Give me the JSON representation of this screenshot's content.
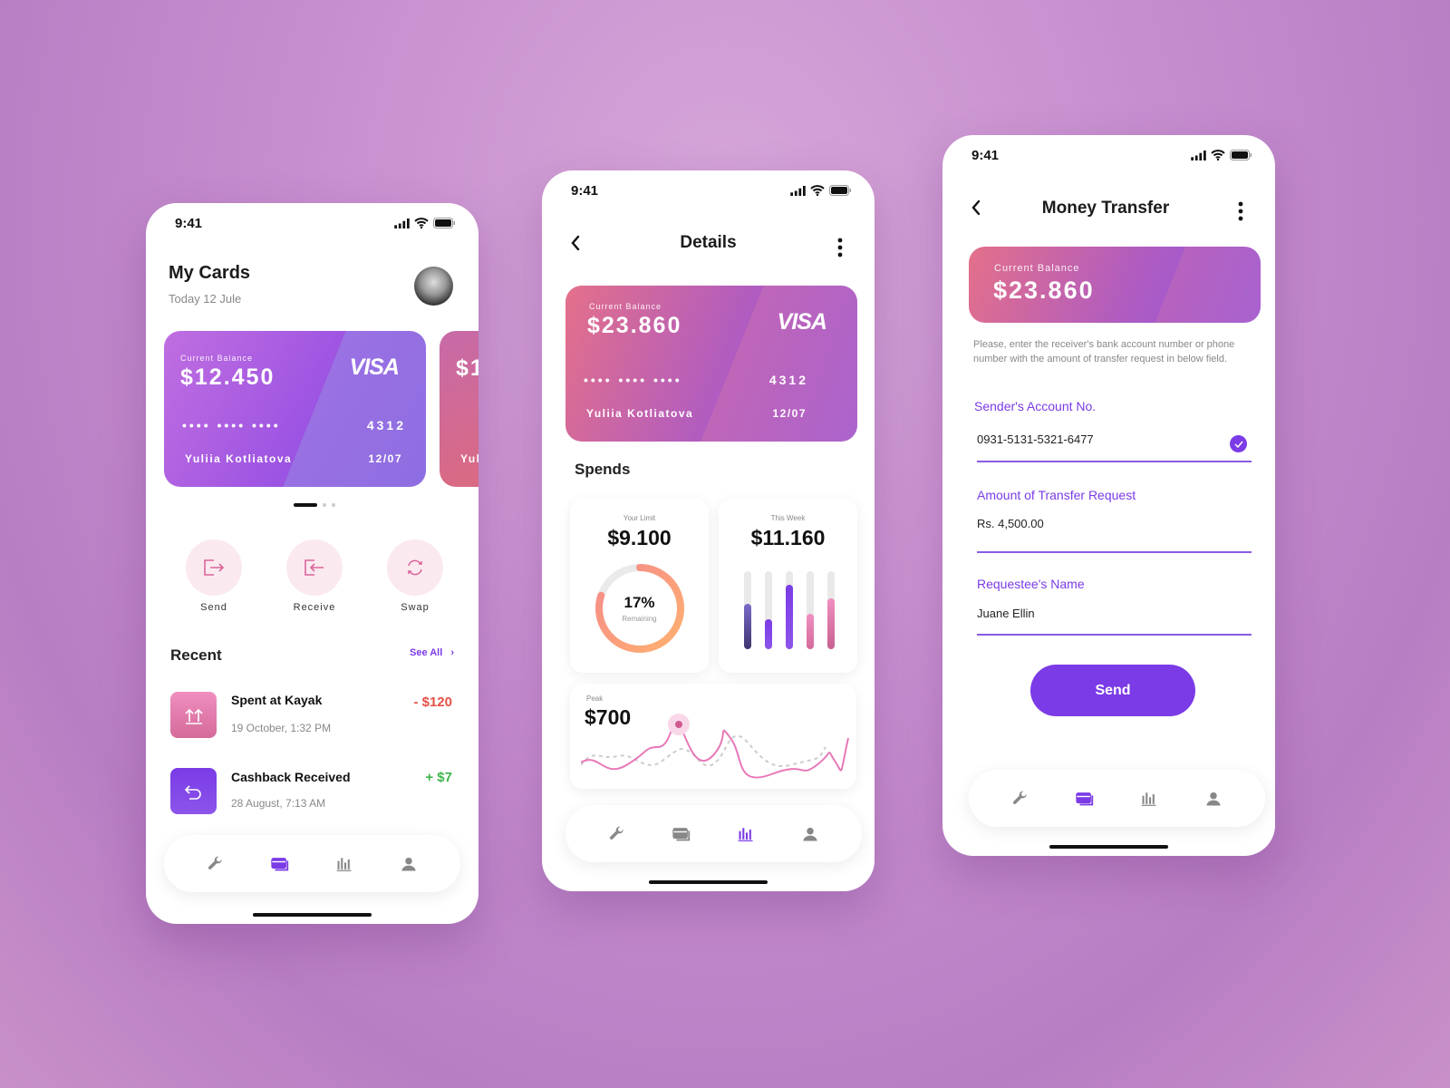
{
  "status_time": "9:41",
  "colors": {
    "accent": "#7b3be6",
    "negative": "#e65046",
    "positive": "#3cb54a",
    "action_bg": "#fbe9f0"
  },
  "nav_icons": [
    "wrench-icon",
    "cards-icon",
    "chart-icon",
    "user-icon"
  ],
  "my_cards": {
    "title": "My Cards",
    "date": "Today 12 Jule",
    "card": {
      "balance_label": "Current Balance",
      "balance": "$12.450",
      "brand": "VISA",
      "dots": "•••• •••• ••••",
      "last4": "4312",
      "holder": "Yuliia Kotliatova",
      "expiry": "12/07"
    },
    "card2": {
      "balance": "$1",
      "holder": "Yul"
    },
    "actions": [
      {
        "label": "Send",
        "icon": "send-icon"
      },
      {
        "label": "Receive",
        "icon": "receive-icon"
      },
      {
        "label": "Swap",
        "icon": "swap-icon"
      }
    ],
    "recent_title": "Recent",
    "see_all": "See All",
    "transactions": [
      {
        "title": "Spent at Kayak",
        "date": "19 October, 1:32 PM",
        "amount": "- $120",
        "type": "negative"
      },
      {
        "title": "Cashback Received",
        "date": "28 August, 7:13 AM",
        "amount": "+ $7",
        "type": "positive"
      }
    ],
    "active_nav": 1
  },
  "details": {
    "title": "Details",
    "card": {
      "balance_label": "Current Balance",
      "balance": "$23.860",
      "brand": "VISA",
      "dots": "•••• •••• ••••",
      "last4": "4312",
      "holder": "Yuliia Kotliatova",
      "expiry": "12/07"
    },
    "spends_title": "Spends",
    "limit": {
      "label": "Your Limit",
      "amount": "$9.100",
      "percent": "17%",
      "percent_label": "Remaining",
      "fill_fraction": 0.8
    },
    "week": {
      "label": "This Week",
      "amount": "$11.160",
      "bars": [
        0.58,
        0.38,
        0.83,
        0.45,
        0.65
      ]
    },
    "peak": {
      "label": "Peak",
      "amount": "$700"
    },
    "active_nav": 2
  },
  "transfer": {
    "title": "Money Transfer",
    "card": {
      "balance_label": "Current Balance",
      "balance": "$23.860"
    },
    "help": "Please, enter the receiver's bank account number or phone number with the amount of transfer request in below field.",
    "fields": [
      {
        "label": "Sender's Account No.",
        "value": "0931-5131-5321-6477",
        "verified": true
      },
      {
        "label": "Amount of Transfer Request",
        "value": "Rs. 4,500.00"
      },
      {
        "label": "Requestee's Name",
        "value": "Juane Ellin"
      }
    ],
    "send_label": "Send",
    "active_nav": 1
  }
}
